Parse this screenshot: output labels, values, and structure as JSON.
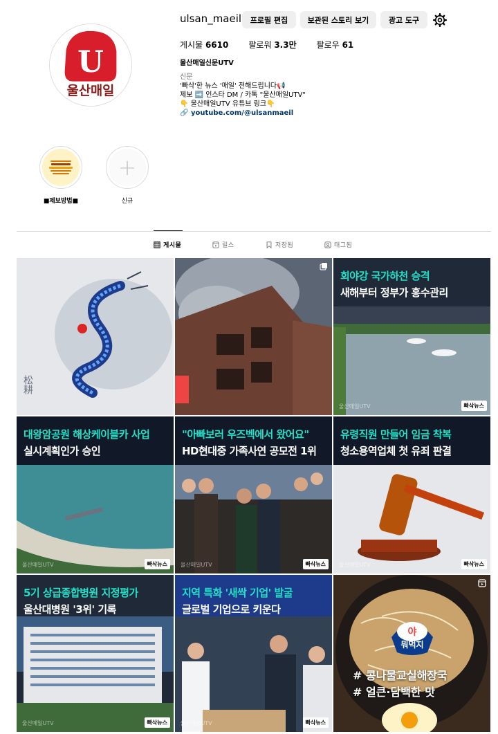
{
  "profile": {
    "username": "ulsan_maeil",
    "logo_text": "울산매일",
    "logo_letter": "U",
    "buttons": {
      "edit": "프로필 편집",
      "archive": "보관된 스토리 보기",
      "ad_tools": "광고 도구"
    },
    "settings_icon": "gear-icon",
    "stats": [
      {
        "label": "게시물",
        "value": "6610"
      },
      {
        "label": "팔로워",
        "value": "3.3만"
      },
      {
        "label": "팔로우",
        "value": "61"
      }
    ],
    "full_name": "울산매일신문UTV",
    "category": "신문",
    "bio_lines": [
      "'빠삭'한 뉴스 '매일' 전해드립니다📢",
      "제보 ➡️ 인스타 DM / 카톡 \"울산매일UTV\"",
      "👇 울산매일UTV 유튜브 링크👇"
    ],
    "link": "youtube.com/@ulsanmaeil"
  },
  "highlights": [
    {
      "label": "■제보방법■",
      "type": "story"
    },
    {
      "label": "신규",
      "type": "new"
    }
  ],
  "tabs": [
    {
      "label": "게시물",
      "icon": "grid-icon",
      "active": true
    },
    {
      "label": "릴스",
      "icon": "reels-icon",
      "active": false
    },
    {
      "label": "저장됨",
      "icon": "bookmark-icon",
      "active": false
    },
    {
      "label": "태그됨",
      "icon": "tagged-icon",
      "active": false
    }
  ],
  "posts": [
    {
      "kind": "painting",
      "signature": "松耕"
    },
    {
      "kind": "photo",
      "multi": true
    },
    {
      "kind": "news",
      "line1": "회야강 국가하천 승격",
      "line2": "새해부터 정부가 홍수관리",
      "watermark": "울산매일UTV",
      "badge": "빠삭뉴스"
    },
    {
      "kind": "news",
      "line1": "대왕암공원 해상케이블카 사업",
      "line2": "실시계획인가 승인",
      "watermark": "울산매일UTV",
      "badge": "빠삭뉴스"
    },
    {
      "kind": "news",
      "line1": "\"아빠보러 우즈벡에서 왔어요\"",
      "line2": "HD현대중 가족사연 공모전 1위",
      "watermark": "울산매일UTV",
      "badge": "빠삭뉴스"
    },
    {
      "kind": "news",
      "line1": "유령직원 만들어 임금 착복",
      "line2": "청소용역업체 첫 유죄 판결",
      "watermark": "울산매일UTV",
      "badge": "빠삭뉴스"
    },
    {
      "kind": "news",
      "line1": "5기 상급종합병원 지정평가",
      "line2": "울산대병원 '3위' 기록",
      "watermark": "울산매일UTV",
      "badge": "빠삭뉴스"
    },
    {
      "kind": "news",
      "line1": "지역 특화 '새싹 기업' 발굴",
      "line2": "글로벌 기업으로 키운다",
      "watermark": "울산매일UTV",
      "badge": "빠삭뉴스"
    },
    {
      "kind": "food",
      "logo_top": "야",
      "logo_bottom": "뭐먹지",
      "tag1": "# 콩나물교실해장국",
      "tag2": "# 얼큰·담백한 맛",
      "reel": true
    }
  ],
  "colors": {
    "accent_teal": "#21e0c8",
    "brand_red": "#d91e2b",
    "link": "#00376b"
  }
}
